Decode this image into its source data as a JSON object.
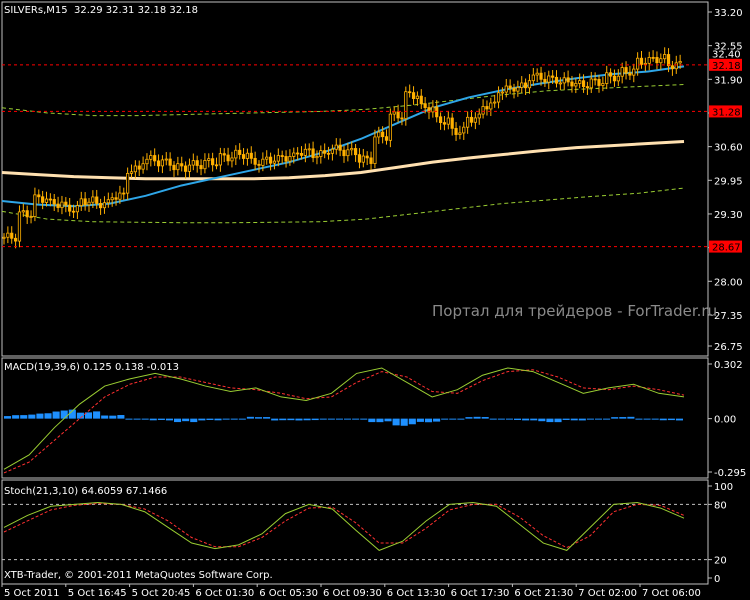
{
  "header": {
    "symbol_label": "SILVERs,M15",
    "ohlc": "32.29 32.31 32.18 32.18"
  },
  "macd_header": {
    "label": "MACD(19,39,6)",
    "values": "0.125 0.138 -0.013"
  },
  "stoch_header": {
    "label": "Stoch(21,3,10)",
    "values": "64.6059 67.1466"
  },
  "footer": "XTB-Trader, © 2001-2011 MetaQuotes Software Corp.",
  "watermark": "Портал для трейдеров - ForTrader.ru",
  "colors": {
    "background": "#000000",
    "grid": "#c0c0c0",
    "candle": "#ffb000",
    "ma_fast": "#2ea6e8",
    "ma_slow": "#ffe0b0",
    "envelope": "#9acd32",
    "level_line": "#ff0000",
    "macd_hist": "#1e90ff",
    "macd_signal": "#ff3030",
    "macd_main": "#9acd32",
    "stoch": "#9acd32",
    "stoch_signal": "#ff3030"
  },
  "chart_data": [
    {
      "type": "candlestick",
      "title": "SILVERs,M15",
      "ylim": [
        26.75,
        33.2
      ],
      "y_ticks": [
        "33.20",
        "32.55",
        "31.90",
        "31.25",
        "30.60",
        "29.95",
        "29.30",
        "28.65",
        "28.00",
        "27.35",
        "26.75"
      ],
      "x_ticks": [
        "5 Oct 2011",
        "5 Oct 16:45",
        "5 Oct 20:45",
        "6 Oct 01:30",
        "6 Oct 05:30",
        "6 Oct 09:30",
        "6 Oct 13:30",
        "6 Oct 17:30",
        "6 Oct 21:30",
        "7 Oct 02:00",
        "7 Oct 06:00"
      ],
      "close_series": [
        28.85,
        29.3,
        29.6,
        29.5,
        29.4,
        29.55,
        29.5,
        29.65,
        30.15,
        30.35,
        30.3,
        30.2,
        30.25,
        30.3,
        30.4,
        30.45,
        30.3,
        30.35,
        30.4,
        30.5,
        30.45,
        30.55,
        30.5,
        30.35,
        30.8,
        31.2,
        31.6,
        31.35,
        31.1,
        30.9,
        31.15,
        31.4,
        31.7,
        31.75,
        31.95,
        31.9,
        31.85,
        31.8,
        31.85,
        31.95,
        32.05,
        32.25,
        32.3,
        32.18
      ],
      "series": [
        {
          "name": "MA fast",
          "values": [
            29.55,
            29.48,
            29.45,
            29.5,
            29.65,
            29.85,
            30.0,
            30.15,
            30.3,
            30.5,
            30.75,
            31.05,
            31.35,
            31.55,
            31.7,
            31.82,
            31.92,
            32.0,
            32.05,
            32.15
          ]
        },
        {
          "name": "MA slow",
          "values": [
            30.1,
            30.06,
            30.02,
            30.0,
            29.98,
            29.98,
            29.98,
            29.98,
            30.0,
            30.04,
            30.1,
            30.2,
            30.3,
            30.38,
            30.45,
            30.52,
            30.58,
            30.62,
            30.66,
            30.7
          ]
        },
        {
          "name": "Envelope upper",
          "values": [
            31.35,
            31.25,
            31.2,
            31.2,
            31.22,
            31.24,
            31.26,
            31.28,
            31.32,
            31.4,
            31.5,
            31.6,
            31.68,
            31.72,
            31.76,
            31.8
          ]
        },
        {
          "name": "Envelope lower",
          "values": [
            29.35,
            29.2,
            29.15,
            29.14,
            29.13,
            29.13,
            29.14,
            29.15,
            29.2,
            29.3,
            29.4,
            29.5,
            29.57,
            29.64,
            29.7,
            29.8
          ]
        }
      ],
      "levels": [
        {
          "value": 32.18,
          "label": "32.18"
        },
        {
          "value": 31.28,
          "label": "31.28"
        },
        {
          "value": 28.67,
          "label": "28.67"
        }
      ],
      "last_price_label": "32.18",
      "pair_price_label": "32.40"
    },
    {
      "type": "macd",
      "ylim": [
        -0.295,
        0.302
      ],
      "y_ticks": [
        "0.302",
        "0.00",
        "-0.295"
      ],
      "series": [
        {
          "name": "main",
          "values": [
            -0.28,
            -0.2,
            -0.05,
            0.08,
            0.18,
            0.22,
            0.25,
            0.22,
            0.18,
            0.15,
            0.17,
            0.12,
            0.1,
            0.14,
            0.25,
            0.28,
            0.2,
            0.12,
            0.16,
            0.24,
            0.28,
            0.26,
            0.2,
            0.14,
            0.17,
            0.19,
            0.14,
            0.12
          ]
        },
        {
          "name": "signal",
          "values": [
            -0.3,
            -0.24,
            -0.12,
            0.0,
            0.12,
            0.19,
            0.23,
            0.23,
            0.2,
            0.17,
            0.16,
            0.14,
            0.11,
            0.12,
            0.2,
            0.26,
            0.23,
            0.15,
            0.14,
            0.21,
            0.26,
            0.27,
            0.23,
            0.17,
            0.16,
            0.18,
            0.16,
            0.13
          ]
        },
        {
          "name": "histogram",
          "values": [
            0.02,
            0.03,
            0.05,
            0.04,
            0.02,
            0.0,
            -0.01,
            -0.02,
            -0.01,
            0.0,
            0.01,
            -0.01,
            -0.01,
            0.0,
            0.0,
            -0.02,
            -0.04,
            -0.02,
            0.0,
            0.01,
            0.0,
            -0.01,
            -0.02,
            -0.01,
            0.0,
            0.01,
            0.0,
            -0.01
          ]
        }
      ]
    },
    {
      "type": "stochastic",
      "ylim": [
        0,
        100
      ],
      "y_ticks": [
        "100",
        "80",
        "20",
        "0"
      ],
      "series": [
        {
          "name": "main",
          "values": [
            55,
            68,
            78,
            80,
            82,
            80,
            72,
            55,
            38,
            32,
            36,
            48,
            70,
            80,
            75,
            52,
            30,
            40,
            62,
            80,
            82,
            78,
            58,
            38,
            30,
            55,
            80,
            82,
            76,
            65
          ]
        },
        {
          "name": "signal",
          "values": [
            50,
            62,
            74,
            79,
            81,
            80,
            75,
            62,
            44,
            34,
            34,
            44,
            62,
            76,
            77,
            60,
            38,
            38,
            54,
            74,
            80,
            80,
            66,
            46,
            33,
            46,
            72,
            80,
            79,
            68
          ]
        }
      ]
    }
  ]
}
